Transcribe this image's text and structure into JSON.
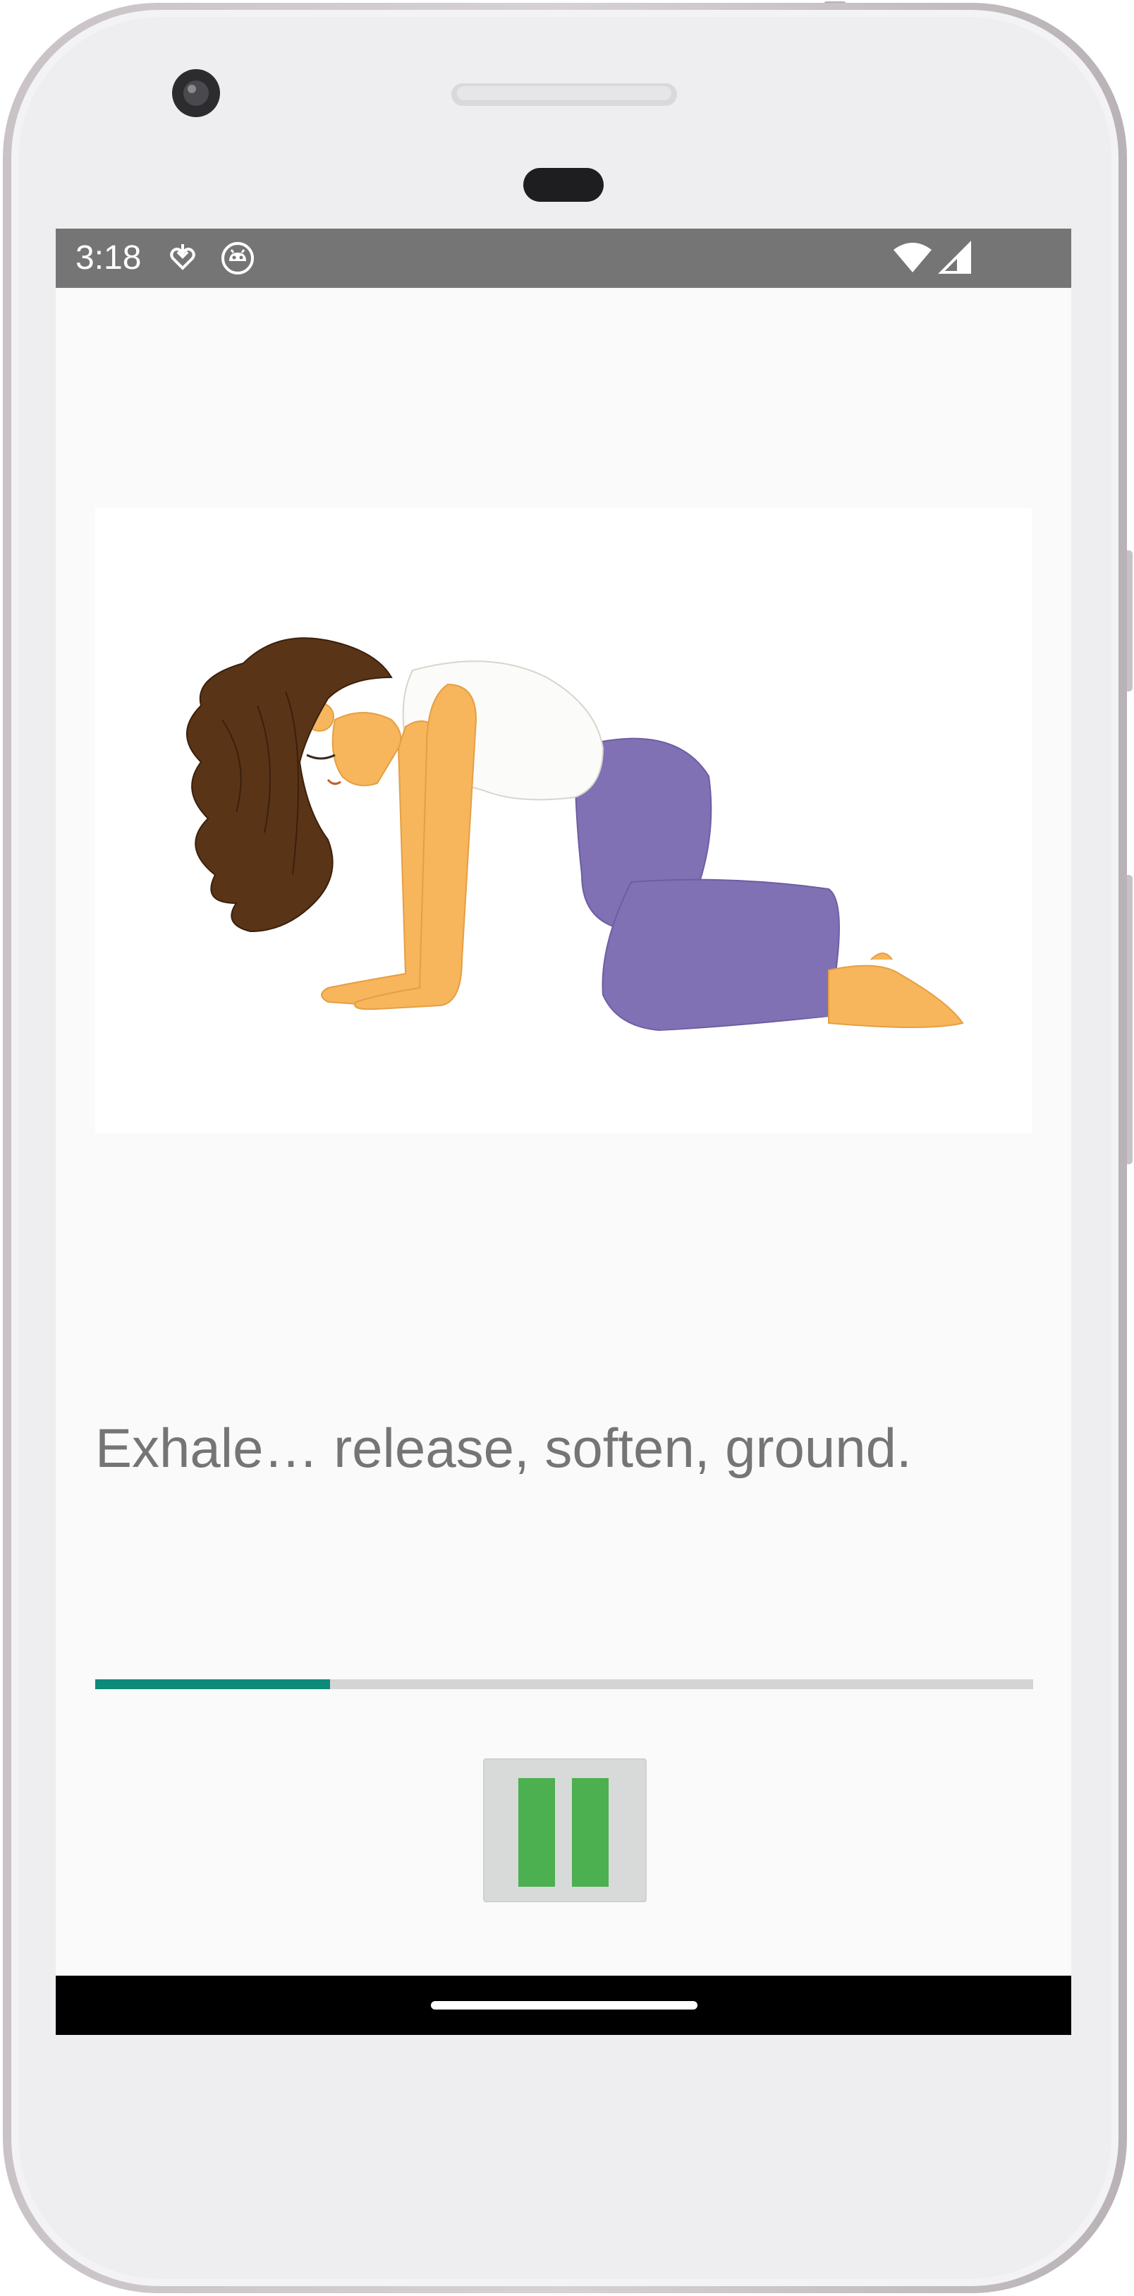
{
  "status_bar": {
    "time": "3:18",
    "left_icons": [
      "download-heart-icon",
      "android-debug-icon"
    ],
    "right_icons": [
      "wifi-icon",
      "cell-signal-icon"
    ]
  },
  "exercise": {
    "image": "cat-cow-pose-illustration",
    "instruction": "Exhale… release, soften, ground.",
    "progress_fraction": 0.25
  },
  "controls": {
    "pause_icon": "pause-icon"
  },
  "colors": {
    "status_bar": "#757575",
    "progress_track": "#d4d4d4",
    "progress_fill": "#0d8a78",
    "pause_bars": "#4caf50",
    "pause_button_bg": "#d8dad9",
    "text": "#757575"
  }
}
